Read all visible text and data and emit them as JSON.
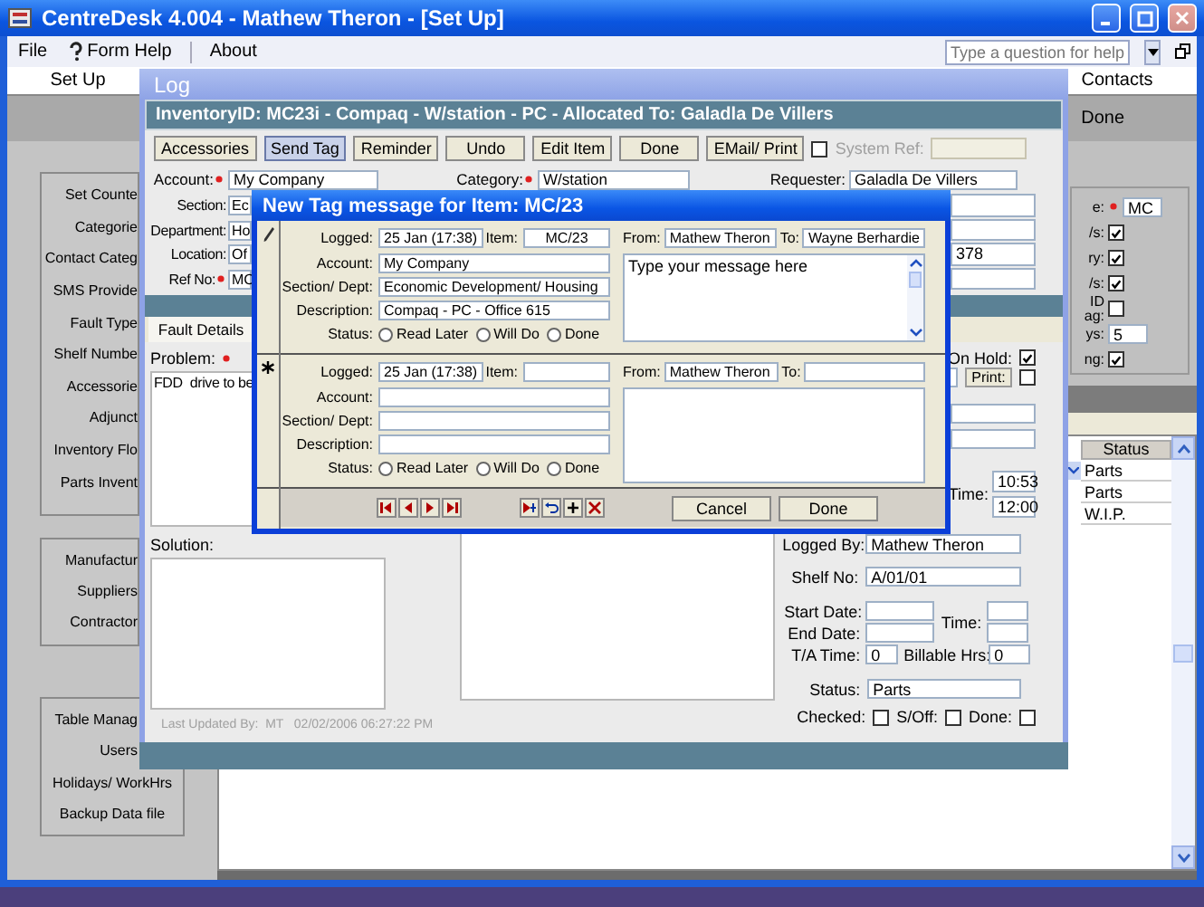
{
  "window": {
    "title": "CentreDesk 4.004 - Mathew Theron - [Set Up]"
  },
  "menu": [
    {
      "kind": "plain",
      "label": "File"
    },
    {
      "kind": "help",
      "label": "Form Help"
    },
    {
      "kind": "plain",
      "label": "About"
    }
  ],
  "help_box": {
    "placeholder": "Type a question for help"
  },
  "tabs": [
    "Set Up",
    "Contacts"
  ],
  "band": {
    "button": "Done"
  },
  "sidebar": {
    "groups": [
      [
        "Set Counte",
        "Categorie",
        "Contact Categ",
        "SMS Provide",
        "Fault Type",
        "Shelf Numbe",
        "Accessorie",
        "Adjunct",
        "Inventory Flo",
        "Parts Invent"
      ],
      [
        "Manufactur",
        "Suppliers",
        "Contractor"
      ],
      [
        "Table Manag",
        "Users",
        "Holidays/ WorkHrs",
        "Backup Data file"
      ]
    ]
  },
  "settings_panel": {
    "rows": [
      {
        "kind": "text",
        "label": "e:",
        "required": true,
        "value": "MC"
      },
      {
        "kind": "check",
        "label": "/s:",
        "checked": true
      },
      {
        "kind": "check",
        "label": "ry:",
        "checked": true
      },
      {
        "kind": "check",
        "label": "/s:",
        "checked": true
      },
      {
        "kind": "check",
        "label": "ID ag:",
        "checked": false
      },
      {
        "kind": "text",
        "label": "ys:",
        "value": "5"
      },
      {
        "kind": "check",
        "label": "ng:",
        "checked": true
      }
    ]
  },
  "status_table": {
    "column": "Status",
    "rows": [
      "Parts",
      "Parts",
      "W.I.P."
    ]
  },
  "log": {
    "title": "Log",
    "header": "InventoryID: MC23i -  Compaq - W/station -  PC - Allocated To: Galadla De Villers",
    "toolbar": [
      {
        "label": "Accessories",
        "pressed": false
      },
      {
        "label": "Send Tag",
        "pressed": true
      },
      {
        "label": "Reminder",
        "pressed": false
      },
      {
        "label": "Undo",
        "pressed": false
      },
      {
        "label": "Edit Item",
        "pressed": false
      },
      {
        "label": "Done",
        "pressed": false
      },
      {
        "label": "EMail/ Print",
        "pressed": false
      }
    ],
    "email_print_checked": false,
    "system_ref": {
      "label": "System Ref:",
      "disabled": true
    },
    "top_fields": [
      {
        "label": "Account:",
        "required": true,
        "value": "My Company"
      },
      {
        "label": "Category:",
        "required": true,
        "value": "W/station"
      },
      {
        "label": "Requester:",
        "required": false,
        "value": "Galadla De Villers"
      }
    ],
    "left_fields": [
      {
        "label": "Section:",
        "required": false,
        "value": "Ec"
      },
      {
        "label": "Department:",
        "required": false,
        "value": "Ho"
      },
      {
        "label": "Location:",
        "required": false,
        "value": "Of"
      },
      {
        "label": "Ref No:",
        "required": true,
        "value": "MC"
      }
    ],
    "right_fields": [
      {
        "value": "378"
      }
    ],
    "fault_tab": "Fault Details",
    "problem": {
      "label": "Problem:",
      "required": true,
      "text": "FDD  drive to be"
    },
    "solution_label": "Solution:",
    "last_updated": "Last Updated By:  MT   02/02/2006 06:27:22 PM",
    "on_hold": {
      "label": "On Hold:",
      "checked": true
    },
    "print": {
      "label": "Print:",
      "checked": false
    },
    "times": {
      "label": "Time:",
      "values": [
        "10:53",
        "12:00"
      ]
    },
    "logged_by": {
      "label": "Logged By:",
      "value": "Mathew Theron"
    },
    "shelf": {
      "label": "Shelf No:",
      "value": "A/01/01"
    },
    "start_date": {
      "label": "Start Date:"
    },
    "end_date": {
      "label": "End Date:"
    },
    "date_time": {
      "label": "Time:"
    },
    "ta_time": {
      "label": "T/A Time:",
      "value": "0"
    },
    "billable": {
      "label": "Billable Hrs:",
      "value": "0"
    },
    "status": {
      "label": "Status:",
      "value": "Parts"
    },
    "flags": [
      {
        "label": "Checked:",
        "checked": false
      },
      {
        "label": "S/Off:",
        "checked": false
      },
      {
        "label": "Done:",
        "checked": false
      }
    ]
  },
  "dialog": {
    "title": "New Tag message for Item: MC/23",
    "records": [
      {
        "kind": "edit",
        "logged": {
          "label": "Logged:",
          "value": "25 Jan (17:38)"
        },
        "item": {
          "label": "Item:",
          "value": "MC/23"
        },
        "from": {
          "label": "From:",
          "value": "Mathew Theron"
        },
        "to": {
          "label": "To:",
          "value": "Wayne Berhardie"
        },
        "account": {
          "label": "Account:",
          "value": "My Company"
        },
        "section": {
          "label": "Section/ Dept:",
          "value": "Economic Development/ Housing"
        },
        "description": {
          "label": "Description:",
          "value": "Compaq - PC - Office 615"
        },
        "message": "Type your message here",
        "status": {
          "label": "Status:",
          "options": [
            {
              "label": "Read Later",
              "selected": false
            },
            {
              "label": "Will Do",
              "selected": false
            },
            {
              "label": "Done",
              "selected": false
            }
          ]
        }
      },
      {
        "kind": "new",
        "logged": {
          "label": "Logged:",
          "value": "25 Jan (17:38)"
        },
        "item": {
          "label": "Item:"
        },
        "from": {
          "label": "From:",
          "value": "Mathew Theron"
        },
        "to": {
          "label": "To:"
        },
        "account": {
          "label": "Account:"
        },
        "section": {
          "label": "Section/ Dept:"
        },
        "description": {
          "label": "Description:"
        },
        "status": {
          "label": "Status:",
          "options": [
            {
              "label": "Read Later",
              "selected": false
            },
            {
              "label": "Will Do",
              "selected": false
            },
            {
              "label": "Done",
              "selected": false
            }
          ]
        }
      }
    ],
    "buttons": [
      "Cancel",
      "Done"
    ]
  }
}
